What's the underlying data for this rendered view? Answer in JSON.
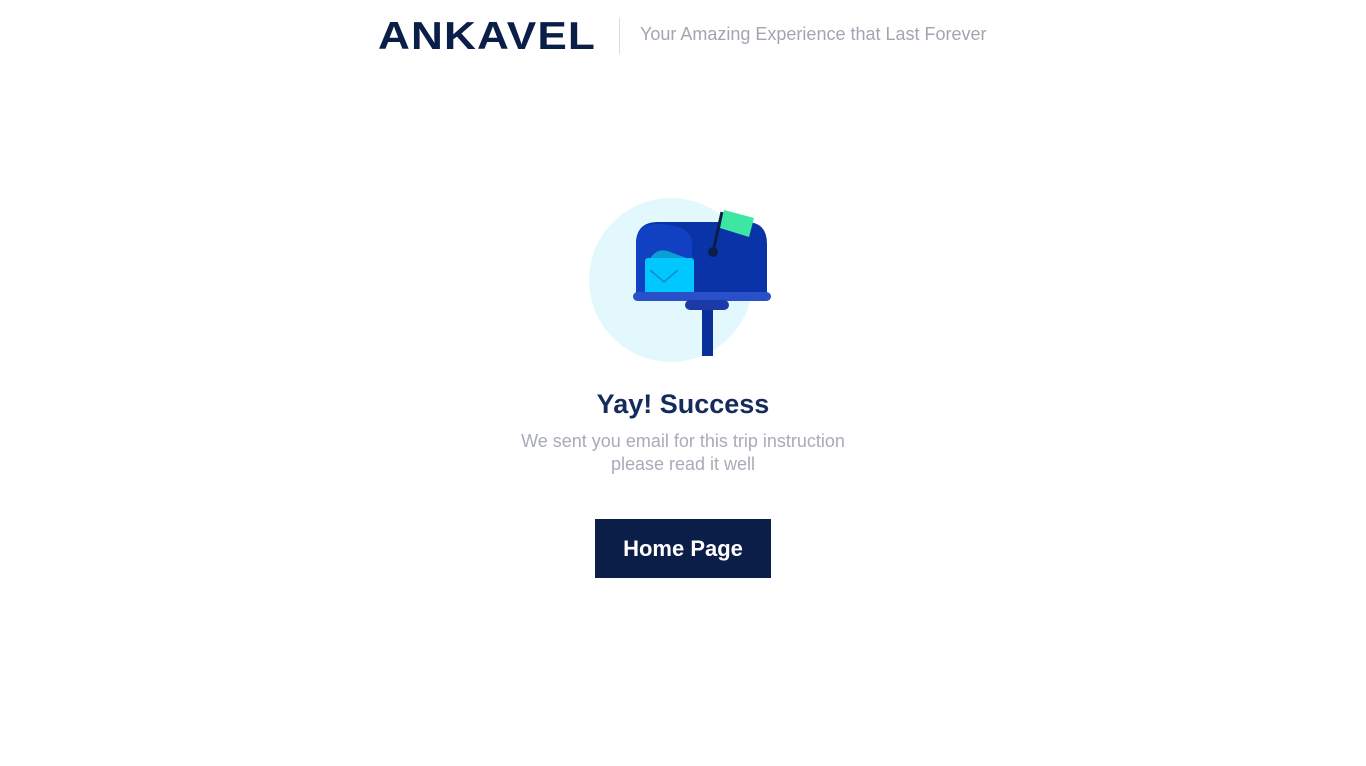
{
  "header": {
    "logo_text": "ANKAVEL",
    "tagline": "Your Amazing Experience that Last Forever"
  },
  "illustration": {
    "name": "mailbox-illustration",
    "colors": {
      "circle": "#e3f8fd",
      "mailbox": "#0a33a8",
      "mailbox_shade": "#1140c2",
      "envelope": "#00c8ff",
      "flag": "#3ee6a3",
      "base": "#2a50c9",
      "pole": "#0a2f9a"
    }
  },
  "main": {
    "title": "Yay! Success",
    "subtitle_line1": "We sent you email for this trip instruction",
    "subtitle_line2": "please read it well",
    "button_label": "Home Page"
  },
  "colors": {
    "primary_dark": "#0a1e47",
    "title": "#152c5b",
    "muted_text": "#a8abb8"
  }
}
